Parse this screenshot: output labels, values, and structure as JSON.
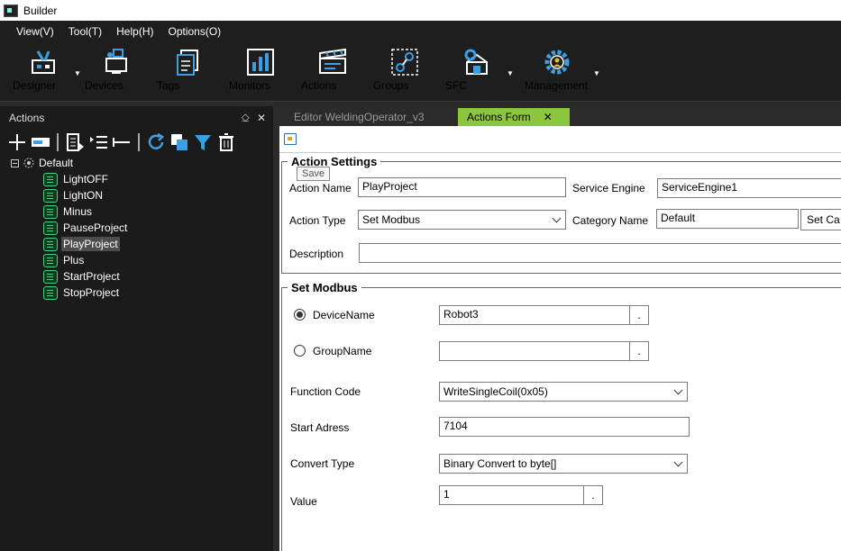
{
  "window": {
    "title": "Builder"
  },
  "menu": [
    "View(V)",
    "Tool(T)",
    "Help(H)",
    "Options(O)"
  ],
  "toolbar": {
    "designer": "Designer",
    "devices": "Devices",
    "tags": "Tags",
    "monitors": "Monitors",
    "actions": "Actions",
    "groups": "Groups",
    "sfc": "SFC",
    "management": "Management"
  },
  "left_panel": {
    "title": "Actions",
    "pin": "⎐",
    "close": "✕",
    "tree": {
      "root": "Default",
      "items": [
        "LightOFF",
        "LightON",
        "Minus",
        "PauseProject",
        "PlayProject",
        "Plus",
        "StartProject",
        "StopProject"
      ],
      "selected": "PlayProject"
    }
  },
  "tabs": {
    "editor": "Editor  WeldingOperator_v3",
    "actions_form": "Actions Form",
    "close": "✕"
  },
  "tooltip": "Save",
  "action_settings": {
    "legend": "Action Settings",
    "action_name_label": "Action Name",
    "action_name_value": "PlayProject",
    "service_engine_label": "Service Engine",
    "service_engine_value": "ServiceEngine1",
    "action_type_label": "Action Type",
    "action_type_value": "Set Modbus",
    "category_name_label": "Category Name",
    "category_name_value": "Default",
    "set_category_button": "Set Ca",
    "description_label": "Description",
    "description_value": ""
  },
  "set_modbus": {
    "legend": "Set Modbus",
    "device_name_label": "DeviceName",
    "device_name_value": "Robot3",
    "group_name_label": "GroupName",
    "group_name_value": "",
    "dots": ".",
    "function_code_label": "Function Code",
    "function_code_value": "WriteSingleCoil(0x05)",
    "start_address_label": "Start Adress",
    "start_address_value": "7104",
    "convert_type_label": "Convert Type",
    "convert_type_value": "Binary Convert to byte[]",
    "value_label": "Value",
    "value_value": "1"
  },
  "colors": {
    "accent_tab": "#8cc63f",
    "leaf_icon": "#47d17a",
    "toolbar_blue": "#1e90d6"
  }
}
